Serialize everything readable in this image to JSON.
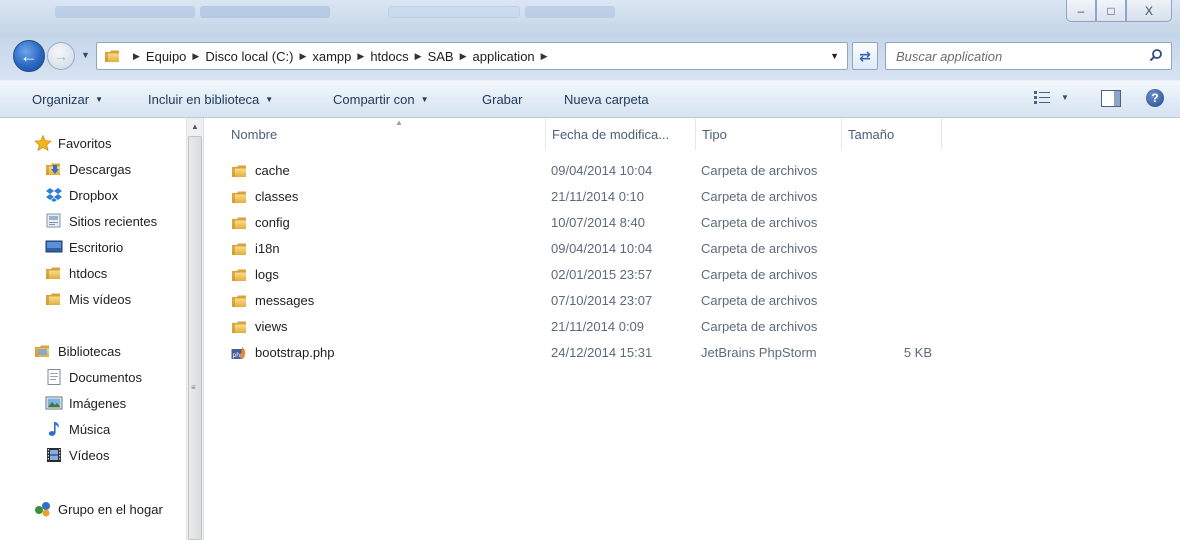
{
  "window": {
    "minimize_glyph": "–",
    "maximize_glyph": "□",
    "close_glyph": "X"
  },
  "address": {
    "breadcrumbs": [
      "Equipo",
      "Disco local (C:)",
      "xampp",
      "htdocs",
      "SAB",
      "application"
    ]
  },
  "search": {
    "placeholder": "Buscar application"
  },
  "toolbar": {
    "organize": "Organizar",
    "include_library": "Incluir en biblioteca",
    "share_with": "Compartir con",
    "burn": "Grabar",
    "new_folder": "Nueva carpeta"
  },
  "sidebar": {
    "favorites": "Favoritos",
    "favorite_items": [
      {
        "label": "Descargas",
        "icon": "downloads-icon"
      },
      {
        "label": "Dropbox",
        "icon": "dropbox-icon"
      },
      {
        "label": "Sitios recientes",
        "icon": "recent-places-icon"
      },
      {
        "label": "Escritorio",
        "icon": "desktop-icon"
      },
      {
        "label": "htdocs",
        "icon": "folder-icon"
      },
      {
        "label": "Mis vídeos",
        "icon": "folder-icon"
      }
    ],
    "libraries": "Bibliotecas",
    "library_items": [
      {
        "label": "Documentos",
        "icon": "documents-icon"
      },
      {
        "label": "Imágenes",
        "icon": "pictures-icon"
      },
      {
        "label": "Música",
        "icon": "music-icon"
      },
      {
        "label": "Vídeos",
        "icon": "videos-icon"
      }
    ],
    "homegroup": "Grupo en el hogar"
  },
  "columns": {
    "name": "Nombre",
    "date": "Fecha de modifica...",
    "type": "Tipo",
    "size": "Tamaño"
  },
  "files": [
    {
      "name": "cache",
      "date": "09/04/2014 10:04",
      "type": "Carpeta de archivos",
      "size": "",
      "icon": "folder-icon"
    },
    {
      "name": "classes",
      "date": "21/11/2014 0:10",
      "type": "Carpeta de archivos",
      "size": "",
      "icon": "folder-icon"
    },
    {
      "name": "config",
      "date": "10/07/2014 8:40",
      "type": "Carpeta de archivos",
      "size": "",
      "icon": "folder-icon"
    },
    {
      "name": "i18n",
      "date": "09/04/2014 10:04",
      "type": "Carpeta de archivos",
      "size": "",
      "icon": "folder-icon"
    },
    {
      "name": "logs",
      "date": "02/01/2015 23:57",
      "type": "Carpeta de archivos",
      "size": "",
      "icon": "folder-icon"
    },
    {
      "name": "messages",
      "date": "07/10/2014 23:07",
      "type": "Carpeta de archivos",
      "size": "",
      "icon": "folder-icon"
    },
    {
      "name": "views",
      "date": "21/11/2014 0:09",
      "type": "Carpeta de archivos",
      "size": "",
      "icon": "folder-icon"
    },
    {
      "name": "bootstrap.php",
      "date": "24/12/2014 15:31",
      "type": "JetBrains PhpStorm",
      "size": "5 KB",
      "icon": "php-file-icon"
    }
  ],
  "colors": {
    "accent": "#1e395b",
    "folder": "#e8b94a",
    "secondary_text": "#5c6a7a"
  }
}
